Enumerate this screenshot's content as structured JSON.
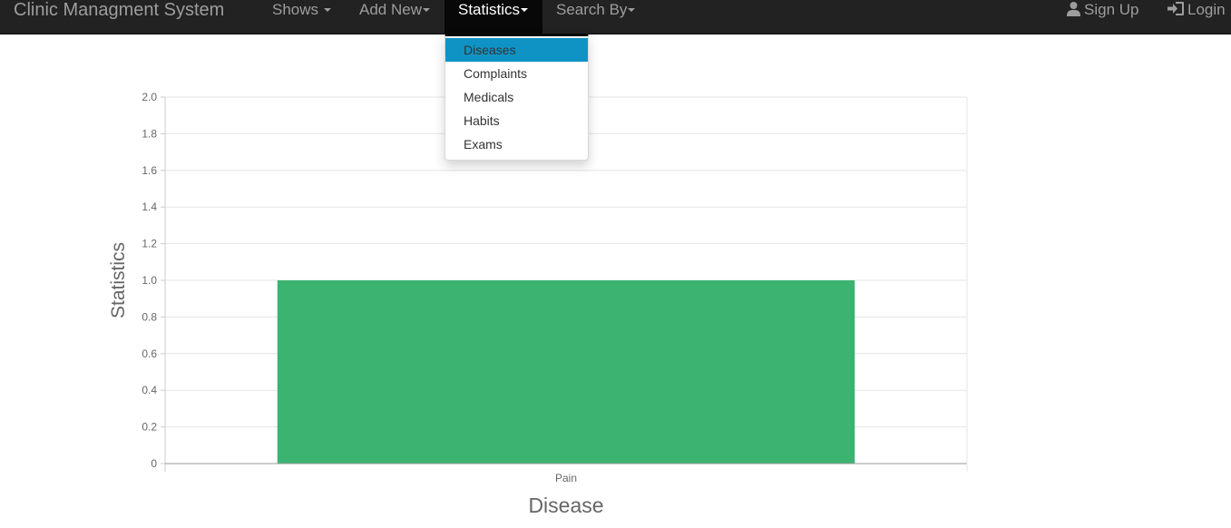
{
  "navbar": {
    "brand": "Clinic Managment System",
    "items": [
      {
        "label": "Shows",
        "has_caret": true
      },
      {
        "label": "Add New",
        "has_caret": true
      },
      {
        "label": "Statistics",
        "has_caret": true,
        "active": true
      },
      {
        "label": "Search By",
        "has_caret": true
      }
    ],
    "right_items": [
      {
        "label": "Sign Up",
        "icon": "user-icon"
      },
      {
        "label": "Login",
        "icon": "login-icon"
      }
    ]
  },
  "dropdown": {
    "items": [
      "Diseases",
      "Complaints",
      "Medicals",
      "Habits",
      "Exams"
    ],
    "selected": "Diseases",
    "highlight_color": "#0f93c4"
  },
  "chart_data": {
    "type": "bar",
    "categories": [
      "Pain"
    ],
    "values": [
      1
    ],
    "xlabel": "Disease",
    "ylabel": "Statistics",
    "ylim": [
      0,
      2.0
    ],
    "yticks": [
      "0",
      "0.2",
      "0.4",
      "0.6",
      "0.8",
      "1.0",
      "1.2",
      "1.4",
      "1.6",
      "1.8",
      "2.0"
    ],
    "grid": true,
    "bar_color": "#3cb371"
  }
}
